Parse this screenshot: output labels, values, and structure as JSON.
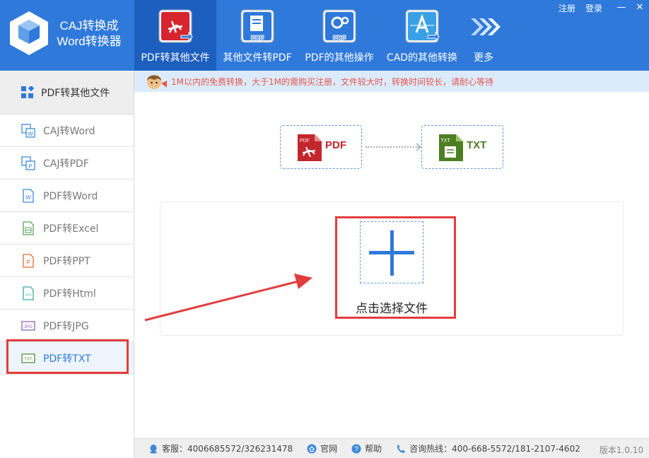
{
  "app": {
    "title_line1": "CAJ转换成",
    "title_line2": "Word转换器"
  },
  "top_links": {
    "register": "注册",
    "login": "登录",
    "minimize": "—",
    "close": "✕"
  },
  "nav": [
    {
      "label": "PDF转其他文件",
      "icon": "pdf-convert-icon",
      "active": true
    },
    {
      "label": "其他文件转PDF",
      "icon": "file-to-pdf-icon",
      "active": false
    },
    {
      "label": "PDF的其他操作",
      "icon": "pdf-settings-icon",
      "active": false
    },
    {
      "label": "CAD的其他转换",
      "icon": "cad-convert-icon",
      "active": false
    },
    {
      "label": "更多",
      "icon": "more-arrows-icon",
      "active": false
    }
  ],
  "sidebar": {
    "header": "PDF转其他文件",
    "items": [
      {
        "label": "CAJ转Word",
        "icon": "caj-word-icon"
      },
      {
        "label": "CAJ转PDF",
        "icon": "caj-pdf-icon"
      },
      {
        "label": "PDF转Word",
        "icon": "word-file-icon"
      },
      {
        "label": "PDF转Excel",
        "icon": "excel-file-icon"
      },
      {
        "label": "PDF转PPT",
        "icon": "ppt-file-icon"
      },
      {
        "label": "PDF转Html",
        "icon": "html-file-icon"
      },
      {
        "label": "PDF转JPG",
        "icon": "jpg-file-icon"
      },
      {
        "label": "PDF转TXT",
        "icon": "txt-file-icon"
      }
    ]
  },
  "notice": "1M以内的免费转换，大于1M的需购买注册，文件较大时，转换时间较长，请耐心等待",
  "conversion": {
    "from": "PDF",
    "to": "TXT",
    "from_tag": "PDF",
    "to_tag": "TXT"
  },
  "upload": {
    "label": "点击选择文件"
  },
  "status": {
    "service": "客服：4006685572/326231478",
    "website": "官网",
    "help": "帮助",
    "hotline": "咨询热线：400-668-5572/181-2107-4602",
    "version": "版本1.0.10"
  },
  "colors": {
    "brand": "#2f79db",
    "brand_dark": "#1d5fbf",
    "highlight": "#e23d3d",
    "notice_text": "#e5584b"
  }
}
